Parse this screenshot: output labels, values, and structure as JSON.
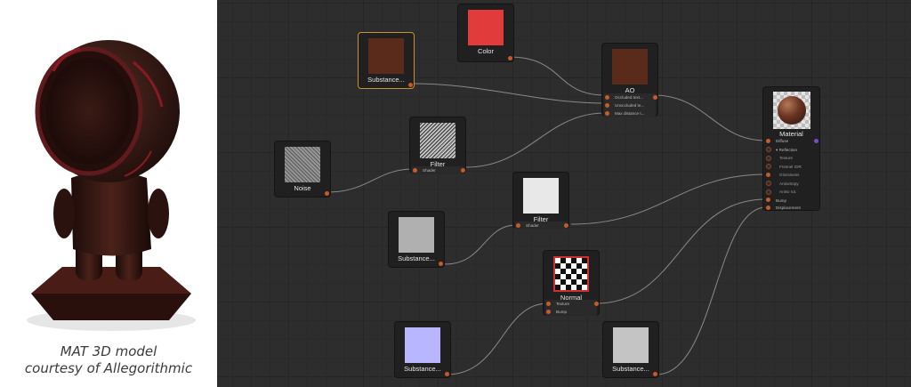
{
  "caption": {
    "line1": "MAT 3D model",
    "line2": "courtesy of Allegorithmic"
  },
  "colors": {
    "background": "#2d2d2d",
    "port": "#c85a2a",
    "selection": "#c8922b",
    "wire": "#9a9a9a",
    "color_swatch": "#e23b3b"
  },
  "nodes": {
    "substance_top": {
      "title": "Substance..."
    },
    "color": {
      "title": "Color"
    },
    "ao": {
      "title": "AO",
      "rows": [
        "Occluded text...",
        "Unoccluded te...",
        "Max distance t..."
      ]
    },
    "noise": {
      "title": "Noise"
    },
    "filter_1": {
      "title": "Filter",
      "rows": [
        "Shader"
      ]
    },
    "filter_2": {
      "title": "Filter",
      "rows": [
        "Shader"
      ]
    },
    "substance_gray": {
      "title": "Substance..."
    },
    "normal": {
      "title": "Normal",
      "rows": [
        "Texture",
        "Bump"
      ]
    },
    "substance_blue": {
      "title": "Substance..."
    },
    "substance_light": {
      "title": "Substance..."
    },
    "material": {
      "title": "Material",
      "rows": [
        "Diffuse",
        "Reflection",
        "Texture",
        "Fresnel IOR",
        "Glossiness",
        "Anisotropy",
        "Aniso rot.",
        "Bump",
        "Displacement"
      ]
    }
  },
  "icons": {
    "preview": "sphere-preview-icon",
    "normal": "checker-icon",
    "expand": "chevron-down-icon"
  }
}
